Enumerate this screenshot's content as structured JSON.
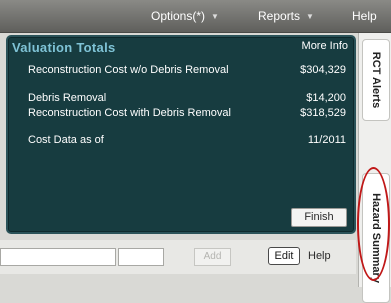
{
  "toolbar": {
    "options_label": "Options(*)",
    "reports_label": "Reports",
    "help_label": "Help"
  },
  "panel": {
    "title": "Valuation Totals",
    "more_info": "More Info",
    "rows": [
      {
        "label": "Reconstruction Cost w/o Debris Removal",
        "value": "$304,329"
      },
      {
        "label": "Debris Removal",
        "value": "$14,200"
      },
      {
        "label": "Reconstruction Cost with Debris Removal",
        "value": "$318,529"
      },
      {
        "label": "Cost Data as of",
        "value": "11/2011"
      }
    ],
    "finish_label": "Finish"
  },
  "side_tabs": {
    "rct_alerts": "RCT Alerts",
    "hazard_summary": "Hazard Summary"
  },
  "bottom": {
    "add_label": "Add",
    "edit_label": "Edit",
    "help_label": "Help"
  },
  "colors": {
    "panel_bg": "#173c40",
    "title_accent": "#7fc3d6",
    "highlight_ring": "#c01818"
  }
}
